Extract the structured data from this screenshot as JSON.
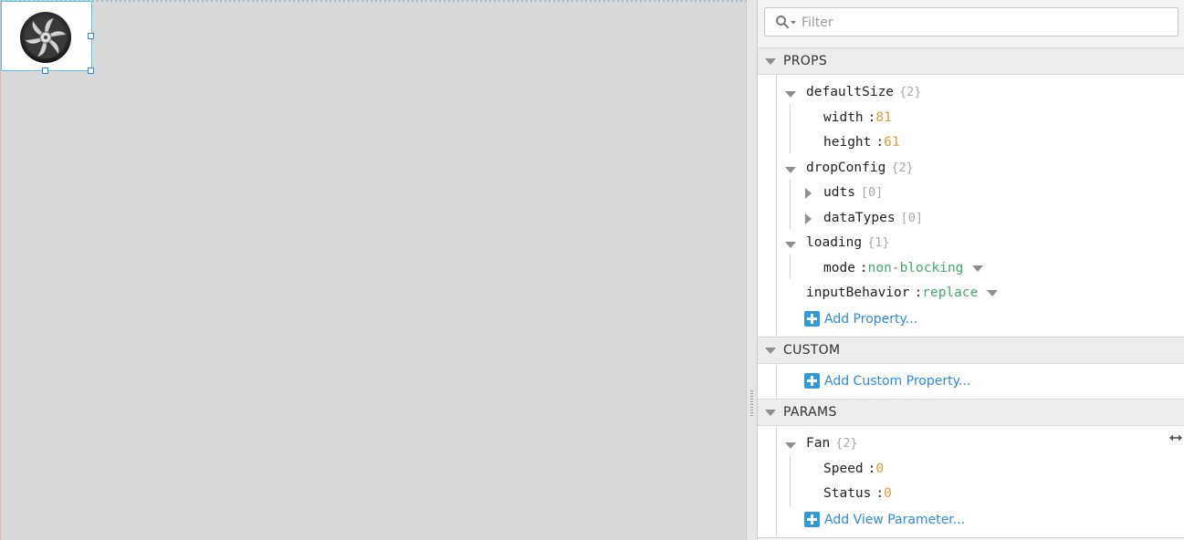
{
  "canvas": {
    "component": {
      "name": "fan-image",
      "selected": true
    }
  },
  "filter": {
    "placeholder": "Filter"
  },
  "sections": {
    "props": {
      "title": "PROPS",
      "defaultSize": {
        "key": "defaultSize",
        "meta": "{2}",
        "width_key": "width",
        "width": "81",
        "height_key": "height",
        "height": "61"
      },
      "dropConfig": {
        "key": "dropConfig",
        "meta": "{2}",
        "udts_key": "udts",
        "udts_meta": "[0]",
        "dataTypes_key": "dataTypes",
        "dataTypes_meta": "[0]"
      },
      "loading": {
        "key": "loading",
        "meta": "{1}",
        "mode_key": "mode",
        "mode": "non-blocking"
      },
      "inputBehavior": {
        "key": "inputBehavior",
        "value": "replace"
      },
      "add_label": "Add Property..."
    },
    "custom": {
      "title": "CUSTOM",
      "add_label": "Add Custom Property..."
    },
    "params": {
      "title": "PARAMS",
      "fan": {
        "key": "Fan",
        "meta": "{2}",
        "speed_key": "Speed",
        "speed": "0",
        "status_key": "Status",
        "status": "0"
      },
      "add_label": "Add View Parameter..."
    }
  },
  "colors": {
    "number": "#e69b2e",
    "string": "#43a86c",
    "accent": "#2e9be0",
    "selection": "#58c2e8"
  }
}
